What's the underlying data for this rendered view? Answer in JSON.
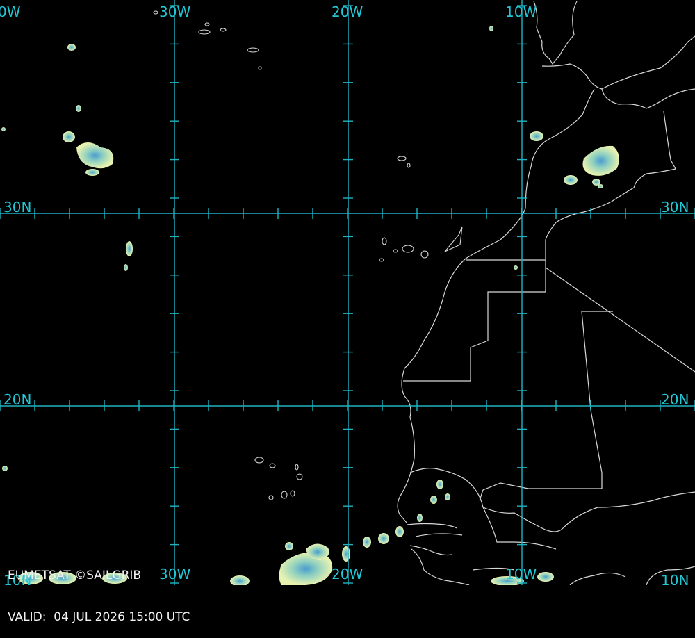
{
  "map": {
    "lon_labels": [
      "0W",
      "30W",
      "20W",
      "10W"
    ],
    "lat_labels": [
      "30N",
      "20N"
    ],
    "bottom_labels": [
      "10N",
      "30W",
      "20W",
      "10W",
      "10N"
    ],
    "colors": {
      "grid": "#1fb3c2",
      "labels": "#22c7d6",
      "coast": "#d8d8d8",
      "background": "#000000"
    }
  },
  "overlay": {
    "credit": "EUMETSAT ©SAILGRIB",
    "valid_label": "VALID:",
    "valid_time": "04 JUL 2026 15:00 UTC"
  }
}
